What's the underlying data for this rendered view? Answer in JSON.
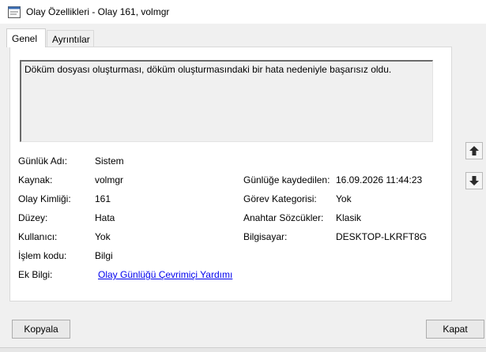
{
  "window": {
    "title": "Olay Özellikleri - Olay 161, volmgr"
  },
  "tabs": [
    {
      "label": "Genel",
      "active": true
    },
    {
      "label": "Ayrıntılar",
      "active": false
    }
  ],
  "description": "Döküm dosyası oluşturması, döküm oluşturmasındaki bir hata nedeniyle başarısız oldu.",
  "fields_left": [
    {
      "label": "Günlük Adı:",
      "value": "Sistem"
    },
    {
      "label": "Kaynak:",
      "value": "volmgr"
    },
    {
      "label": "Olay Kimliği:",
      "value": "161"
    },
    {
      "label": "Düzey:",
      "value": "Hata"
    },
    {
      "label": "Kullanıcı:",
      "value": "Yok"
    },
    {
      "label": "İşlem kodu:",
      "value": "Bilgi"
    },
    {
      "label": "Ek Bilgi:",
      "value": "Olay Günlüğü Çevrimiçi Yardımı"
    }
  ],
  "fields_right": [
    {
      "label": "Günlüğe kaydedilen:",
      "value": "16.09.2026 11:44:23"
    },
    {
      "label": "Görev Kategorisi:",
      "value": "Yok"
    },
    {
      "label": "Anahtar Sözcükler:",
      "value": "Klasik"
    },
    {
      "label": "Bilgisayar:",
      "value": "DESKTOP-LKRFT8G"
    }
  ],
  "buttons": {
    "copy": "Kopyala",
    "close": "Kapat"
  },
  "icons": {
    "app": "event-viewer-icon",
    "up": "arrow-up-icon",
    "down": "arrow-down-icon"
  }
}
